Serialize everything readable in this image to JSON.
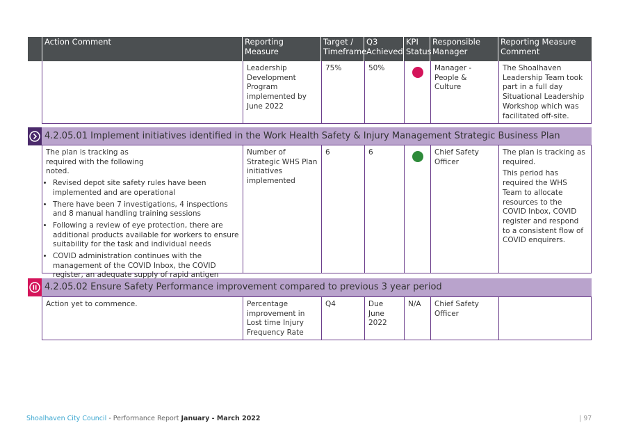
{
  "header": {
    "columns": [
      "Action Comment",
      "Reporting Measure",
      "Target / Timeframe",
      "Q3 Achieved",
      "KPI Status",
      "Responsible Manager",
      "Reporting Measure Comment"
    ]
  },
  "colors": {
    "header_bg": "#4b4f51",
    "section_bg": "#b9a3cc",
    "border": "#6c3f8c",
    "status_red": "#d4145a",
    "status_green": "#2e8b3a",
    "icon_progress": "#4b2a6b",
    "icon_paused": "#d4145a"
  },
  "row1": {
    "comment": "",
    "measure": "Leadership Development Program implemented by June 2022",
    "target": "75%",
    "achieved": "50%",
    "kpi_status": "red",
    "manager": "Manager - People & Culture",
    "measure_comment": "The Shoalhaven Leadership Team took part in a full day Situational Leadership Workshop which was facilitated off-site."
  },
  "section1": {
    "icon": "chevron-right-circle-icon",
    "title": "4.2.05.01 Implement initiatives identified in the Work Health Safety & Injury Management Strategic Business Plan"
  },
  "row2": {
    "comment_intro": "The plan is tracking as required with the following noted.",
    "bullets": [
      "Revised depot site safety rules have been implemented and are operational",
      "There have been 7 investigations, 4 inspections and 8 manual handling training sessions",
      "Following a review of eye protection, there are additional products available for workers to ensure suitability for the task and individual needs",
      "COVID administration continues with the management of the COVID Inbox, the COVID register, an adequate supply of rapid antigen tests, and hygiene products"
    ],
    "measure": "Number of Strategic WHS Plan initiatives implemented",
    "target": "6",
    "achieved": "6",
    "kpi_status": "green",
    "manager": "Chief Safety Officer",
    "measure_comment_1": "The plan is tracking as required.",
    "measure_comment_2": "This period has required the WHS Team to allocate resources to the COVID Inbox, COVID register and respond to a consistent flow of COVID enquirers."
  },
  "section2": {
    "icon": "pause-circle-icon",
    "title": "4.2.05.02 Ensure Safety Performance improvement compared to previous 3 year period"
  },
  "row3": {
    "comment": "Action yet to commence.",
    "measure": "Percentage improvement in Lost time Injury Frequency Rate",
    "target": "Q4",
    "achieved": "Due June 2022",
    "kpi_status": "N/A",
    "manager": "Chief Safety Officer",
    "measure_comment": ""
  },
  "footer": {
    "org": "Shoalhaven City Council",
    "sep": " - ",
    "report": "Performance Report ",
    "period": "January - March 2022",
    "page": "| 97"
  }
}
